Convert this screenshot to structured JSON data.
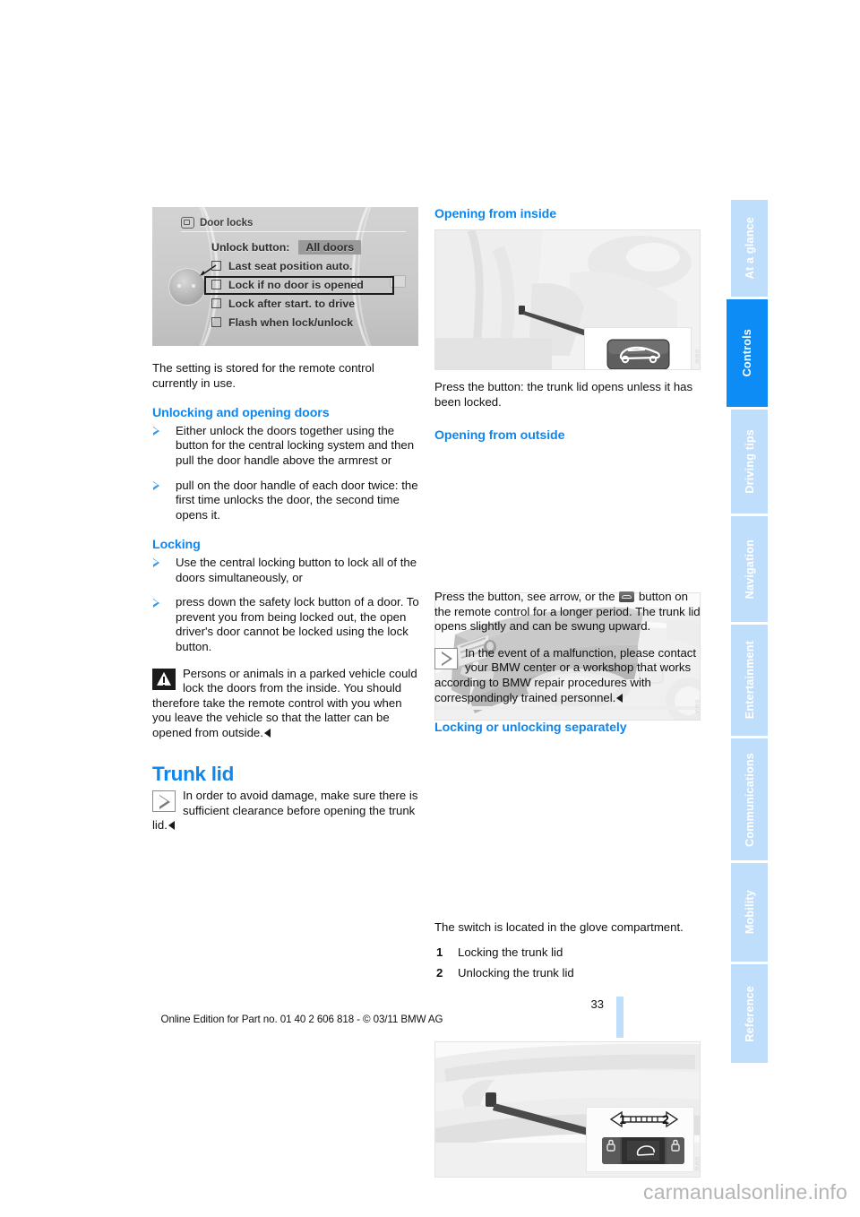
{
  "document": {
    "page_number": "33",
    "footer_note": "Online Edition for Part no. 01 40 2 606 818 - © 03/11 BMW AG",
    "watermark": "carmanualsonline.info"
  },
  "sidebar": {
    "active": "Controls",
    "tabs": [
      {
        "label": "At a glance",
        "active": false
      },
      {
        "label": "Controls",
        "active": true
      },
      {
        "label": "Driving tips",
        "active": false
      },
      {
        "label": "Navigation",
        "active": false
      },
      {
        "label": "Entertainment",
        "active": false
      },
      {
        "label": "Communications",
        "active": false
      },
      {
        "label": "Mobility",
        "active": false
      },
      {
        "label": "Reference",
        "active": false
      }
    ]
  },
  "figures": {
    "door_locks": {
      "caption_title": "Door locks",
      "rows": [
        {
          "label": "Unlock button:",
          "value": "All doors",
          "type": "value"
        },
        {
          "label": "Last seat position auto.",
          "type": "checkbox",
          "checked": false,
          "highlighted": false
        },
        {
          "label": "Lock if no door is opened",
          "type": "checkbox",
          "checked": false,
          "highlighted": true
        },
        {
          "label": "Lock after start. to drive",
          "type": "checkbox",
          "checked": false,
          "highlighted": false
        },
        {
          "label": "Flash when lock/unlock",
          "type": "checkbox",
          "checked": false,
          "highlighted": false
        }
      ]
    },
    "opening_inside": {
      "alt": "Interior trunk release button beside driver's seat"
    },
    "opening_outside": {
      "alt": "Trunk lid handle on rear of vehicle"
    },
    "switch_glovebox": {
      "alt": "Trunk lock switch in glove compartment",
      "marker_1": "1",
      "marker_2": "2"
    }
  },
  "left_column": {
    "intro": "The setting is stored for the remote control currently in use.",
    "unlocking_heading": "Unlocking and opening doors",
    "unlocking_items": [
      "Either unlock the doors together using the button for the central locking system and then pull the door handle above the armrest or",
      "pull on the door handle of each door twice: the first time unlocks the door, the second time opens it."
    ],
    "locking_heading": "Locking",
    "locking_items": [
      "Use the central locking button to lock all of the doors simultaneously, or",
      "press down the safety lock button of a door. To prevent you from being locked out, the open driver's door cannot be locked using the lock button."
    ],
    "warning_text": "Persons or animals in a parked vehicle could lock the doors from the inside. You should therefore take the remote control with you when you leave the vehicle so that the latter can be opened from outside.",
    "trunk_heading": "Trunk lid",
    "trunk_note": "In order to avoid damage, make sure there is sufficient clearance before opening the trunk lid."
  },
  "right_column": {
    "inside_heading": "Opening from inside",
    "inside_text": "Press the button: the trunk lid opens unless it has been locked.",
    "outside_heading": "Opening from outside",
    "outside_text_part1": "Press the button, see arrow, or the",
    "outside_text_part2": "button on the remote control for a longer period. The trunk lid opens slightly and can be swung upward.",
    "outside_note": "In the event of a malfunction, please contact your BMW center or a workshop that works according to BMW repair procedures with correspondingly trained personnel.",
    "separately_heading": "Locking or unlocking separately",
    "switch_text": "The switch is located in the glove compartment.",
    "switch_items": [
      {
        "num": "1",
        "label": "Locking the trunk lid"
      },
      {
        "num": "2",
        "label": "Unlocking the trunk lid"
      }
    ]
  },
  "colors": {
    "heading_blue": "#0d86ee",
    "tab_active": "#0d8cf5",
    "tab_inactive": "#bfdefb"
  }
}
